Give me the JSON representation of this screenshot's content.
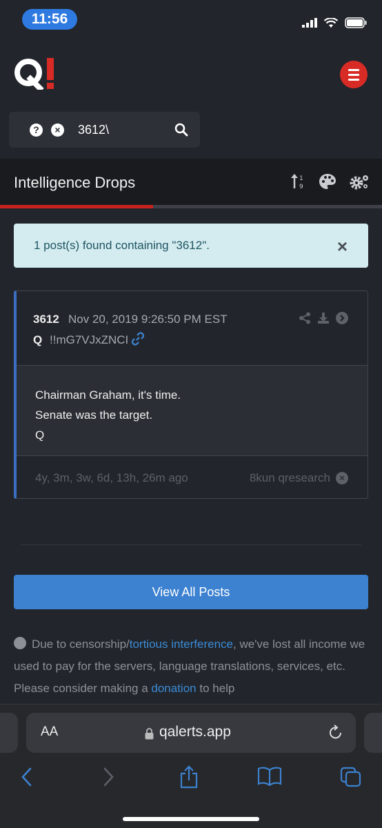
{
  "status_bar": {
    "time": "11:56"
  },
  "header": {
    "logo_text": "Q!",
    "menu_icon": "hamburger-icon"
  },
  "search": {
    "value": "3612\\",
    "help_icon": "question-icon",
    "clear_icon": "clear-icon",
    "search_icon": "search-icon"
  },
  "title_bar": {
    "title": "Intelligence Drops",
    "progress_percent": 40
  },
  "alert": {
    "message": "1 post(s) found containing \"3612\".",
    "close": "×"
  },
  "post": {
    "number": "3612",
    "datetime": "Nov 20, 2019 9:26:50 PM EST",
    "author": "Q",
    "tripcode": "!!mG7VJxZNCI",
    "body": [
      "Chairman Graham, it's time.",
      "Senate was the target.",
      "Q"
    ],
    "ago": "4y, 3m, 3w, 6d, 13h, 26m ago",
    "source": "8kun qresearch"
  },
  "view_all_label": "View All Posts",
  "notice": {
    "part1": "Due to censorship/",
    "link1": "tortious interference",
    "part2": ", we've lost all income we used to pay for the servers, language translations, services, etc. Please consider making a ",
    "link2": "donation",
    "part3": " to help"
  },
  "safari": {
    "aa": "AA",
    "url": "qalerts.app"
  },
  "colors": {
    "accent_red": "#c8221f",
    "accent_blue": "#3d82d0",
    "background": "#22252b"
  }
}
